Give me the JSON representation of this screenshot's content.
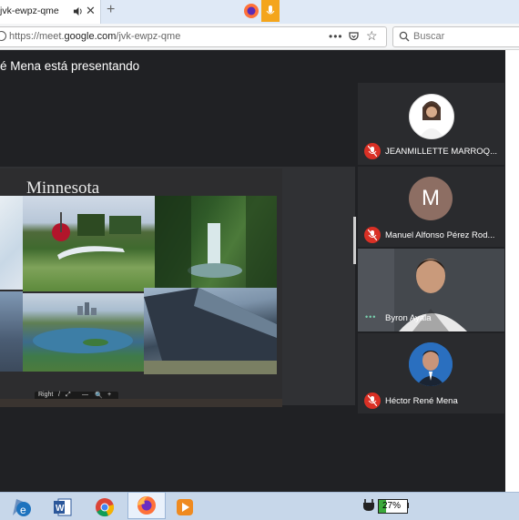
{
  "browser": {
    "tab_title": "jvk-ewpz-qme",
    "new_tab_symbol": "+",
    "url_prefix": "https://meet.",
    "url_domain": "google.com",
    "url_path": "/jvk-ewpz-qme",
    "page_actions": "•••",
    "search_placeholder": "Buscar"
  },
  "meet": {
    "presenting_banner": "é Mena está presentando",
    "slide": {
      "title": "Minnesota",
      "toolbar": [
        "Right",
        "/",
        "⤢",
        "—",
        "🔍",
        "+"
      ]
    },
    "participants": [
      {
        "name": "JEANMILLETTE MARROQ...",
        "muted": true
      },
      {
        "name": "Manuel Alfonso Pérez Rod...",
        "muted": true,
        "initial": "M"
      },
      {
        "name": "Byron Ayala",
        "muted": false
      },
      {
        "name": "Héctor René Mena",
        "muted": true
      }
    ]
  },
  "taskbar": {
    "battery_percent": "27%",
    "battery_level": 0.27
  },
  "colors": {
    "meet_bg": "#202124",
    "mic_muted": "#d93025",
    "accent": "#f4a51c"
  }
}
